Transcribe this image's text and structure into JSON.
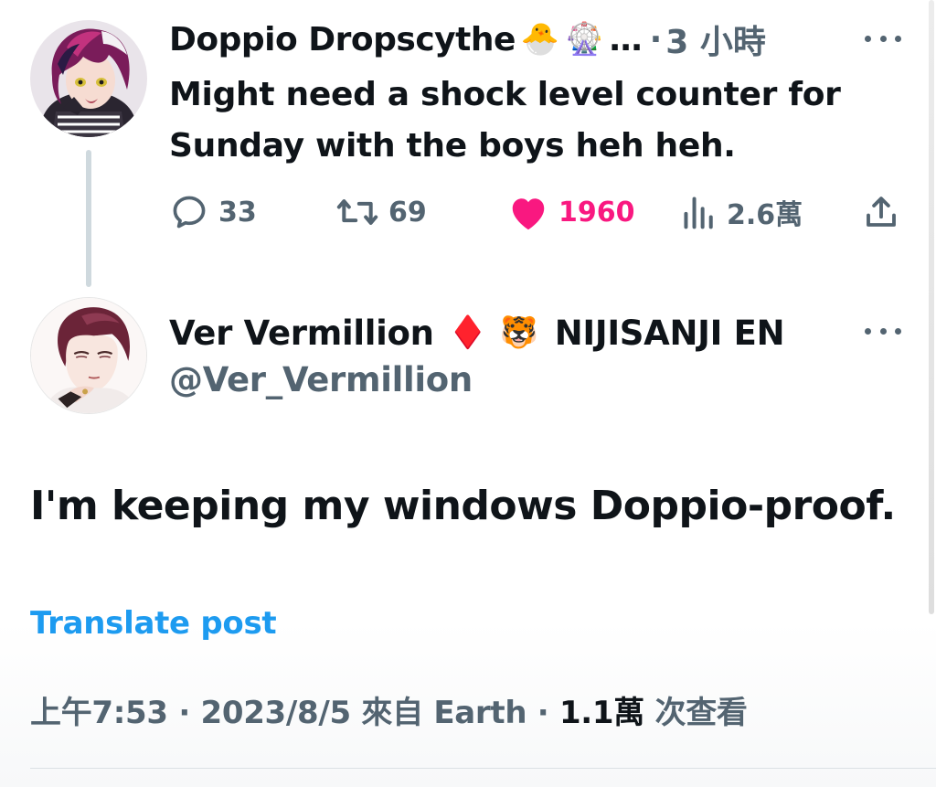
{
  "parent_tweet": {
    "author_name": "Doppio Dropscythe",
    "name_emojis": [
      "🐣",
      "🎡"
    ],
    "ellipsis": "…",
    "separator": "·",
    "time": "3 小時",
    "more_icon": "more-horizontal-icon",
    "text": "Might need a shock level counter for Sunday with the boys heh heh.",
    "actions": {
      "replies": "33",
      "reposts": "69",
      "likes": "1960",
      "views": "2.6萬"
    },
    "like_color": "#f91880"
  },
  "reply_tweet": {
    "author_name": "Ver Vermillion",
    "name_emojis": [
      "♦️",
      "🐯"
    ],
    "affiliation": "NIJISANJI EN",
    "handle": "@Ver_Vermillion",
    "more_icon": "more-horizontal-icon",
    "text": "I'm keeping my windows Doppio-proof.",
    "translate_label": "Translate post",
    "meta": {
      "time": "上午7:53",
      "sep1": " · ",
      "date": "2023/8/5",
      "source": " 來自 Earth",
      "sep2": " · ",
      "views_count": "1.1萬",
      "views_label": " 次查看"
    }
  },
  "colors": {
    "text_primary": "#0f1419",
    "text_secondary": "#536471",
    "link": "#1d9bf0",
    "like": "#f91880"
  }
}
